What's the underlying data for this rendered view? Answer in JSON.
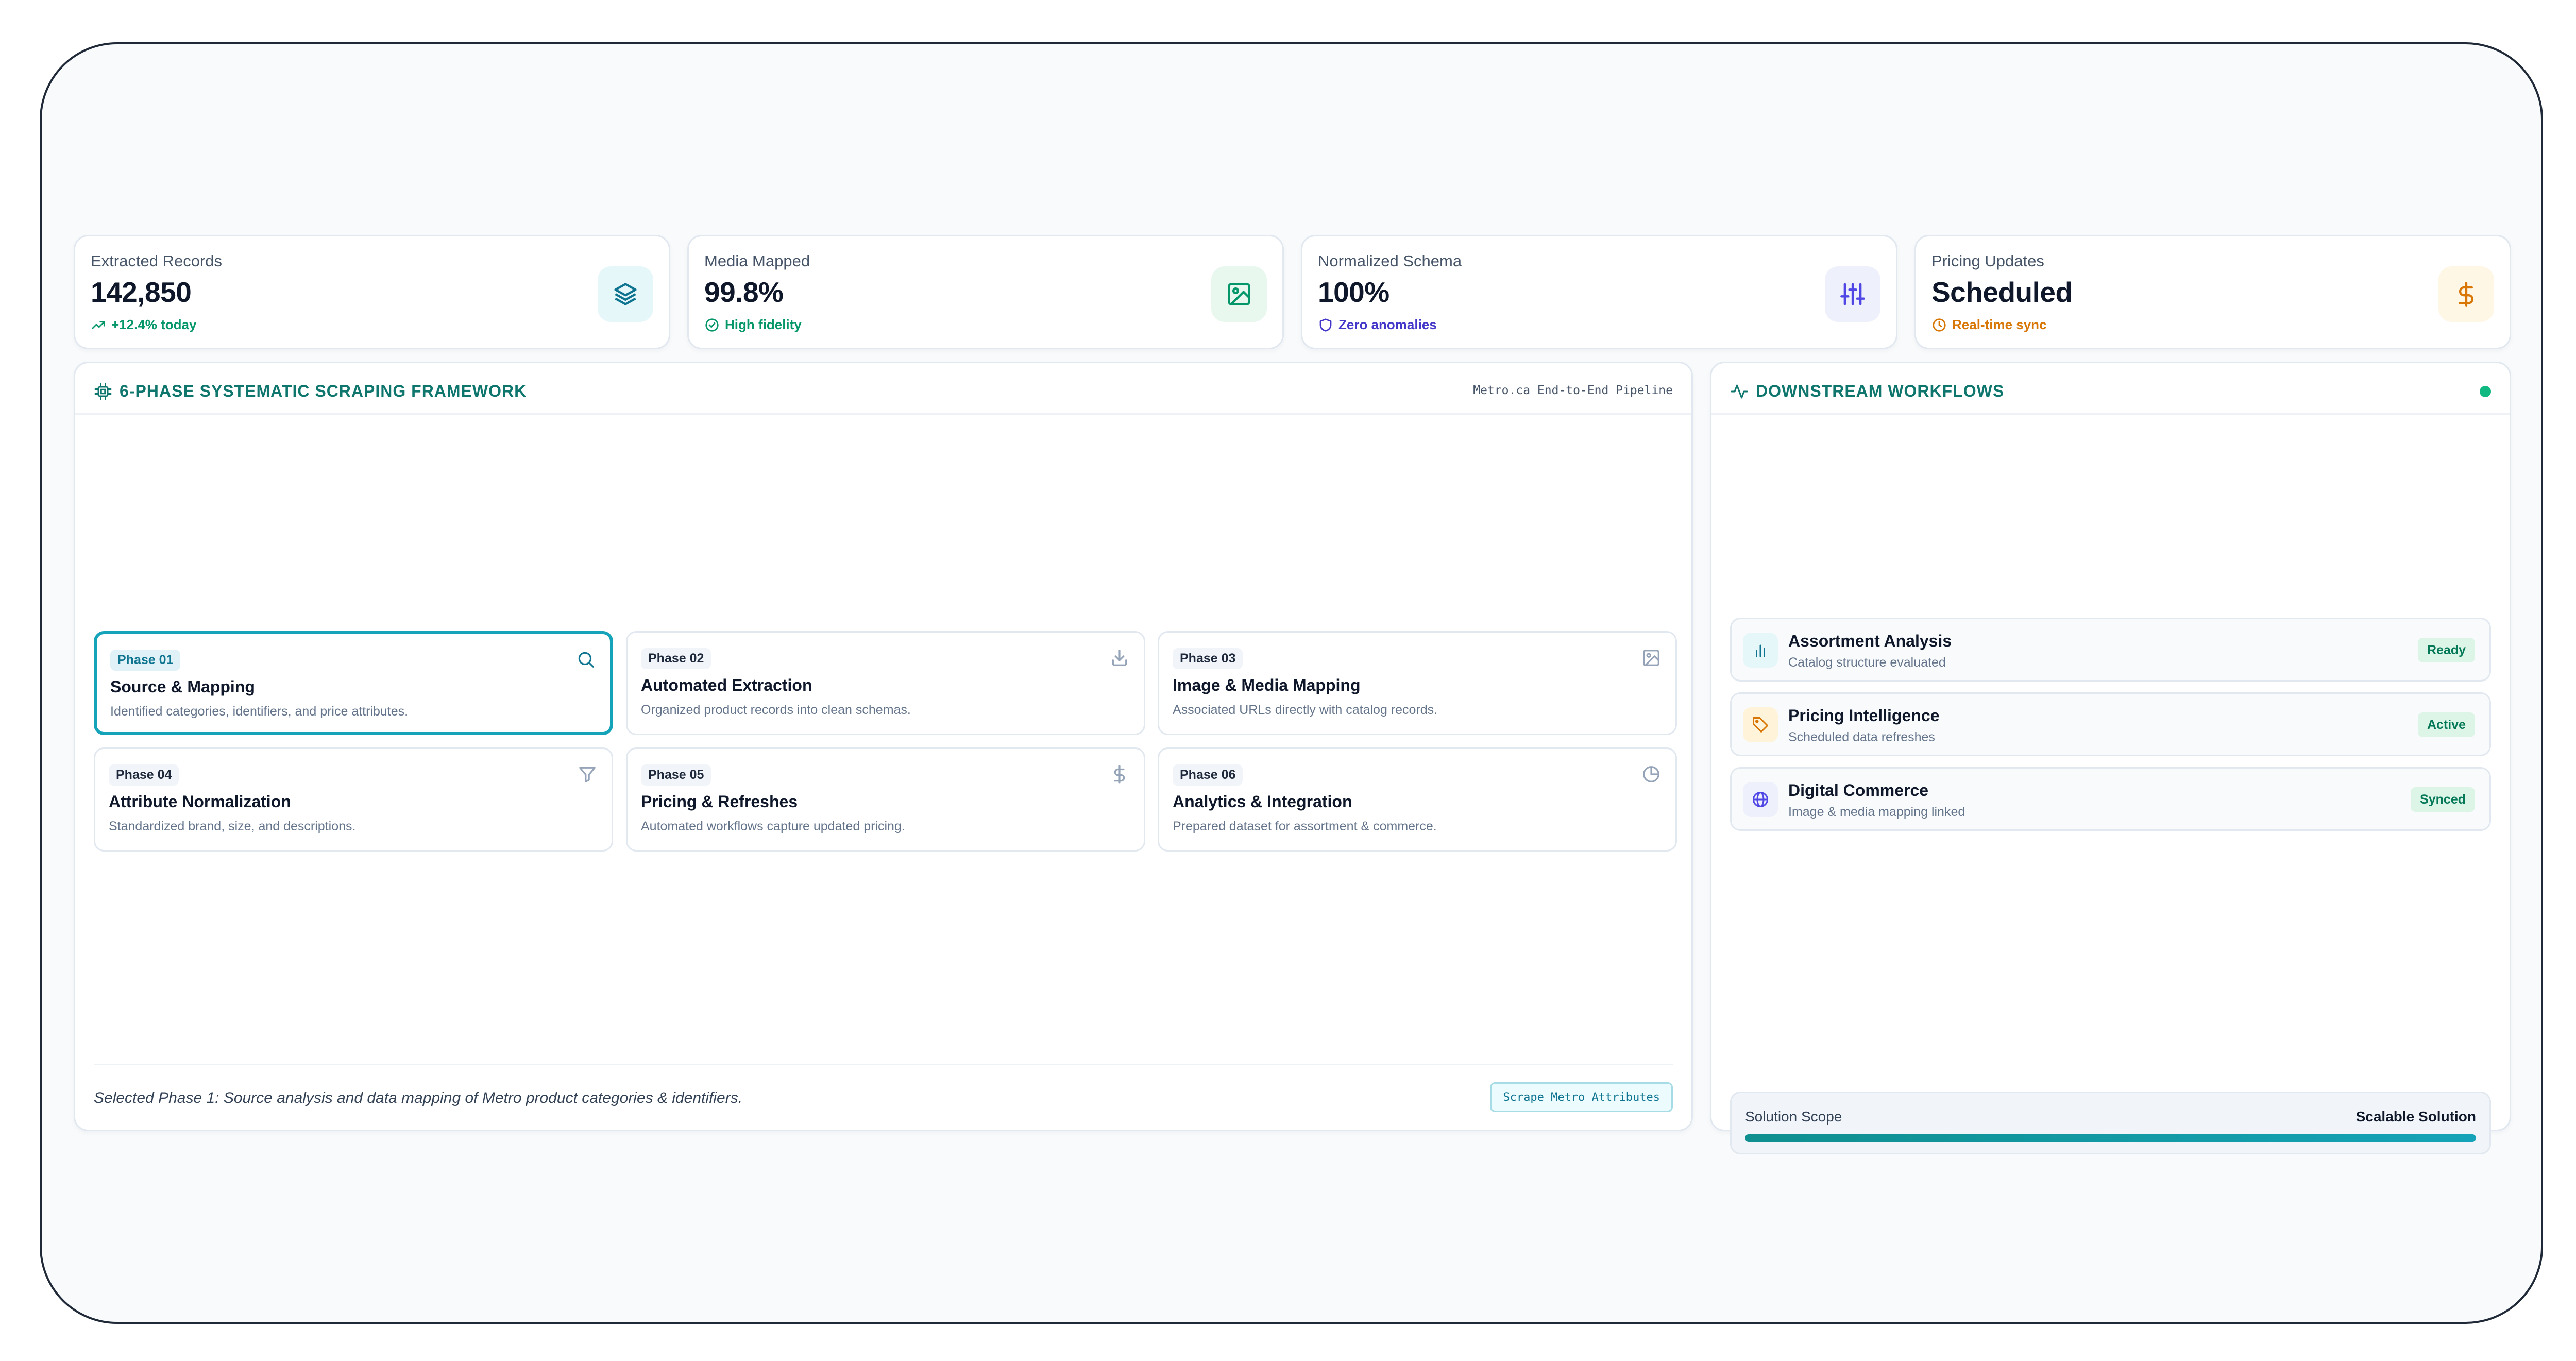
{
  "stats": [
    {
      "label": "Extracted Records",
      "value": "142,850",
      "sub": "+12.4% today",
      "sub_color": "#059669",
      "icon": "layers-icon",
      "icon_bg": "#e6f7fa",
      "icon_color": "#0e7490"
    },
    {
      "label": "Media Mapped",
      "value": "99.8%",
      "sub": "High fidelity",
      "sub_color": "#059669",
      "icon": "image-icon",
      "icon_bg": "#e8f8ef",
      "icon_color": "#059669"
    },
    {
      "label": "Normalized Schema",
      "value": "100%",
      "sub": "Zero anomalies",
      "sub_color": "#4338ca",
      "icon": "sliders-icon",
      "icon_bg": "#eef0fb",
      "icon_color": "#4f46e5"
    },
    {
      "label": "Pricing Updates",
      "value": "Scheduled",
      "sub": "Real-time sync",
      "sub_color": "#d97706",
      "icon": "dollar-icon",
      "icon_bg": "#fff7e6",
      "icon_color": "#d97706"
    }
  ],
  "framework": {
    "title": "6-PHASE SYSTEMATIC SCRAPING FRAMEWORK",
    "tag": "Metro.ca End-to-End Pipeline",
    "phases": [
      {
        "badge": "Phase 01",
        "title": "Source & Mapping",
        "desc": "Identified categories, identifiers, and price attributes.",
        "icon": "search-icon",
        "active": true
      },
      {
        "badge": "Phase 02",
        "title": "Automated Extraction",
        "desc": "Organized product records into clean schemas.",
        "icon": "download-icon",
        "active": false
      },
      {
        "badge": "Phase 03",
        "title": "Image & Media Mapping",
        "desc": "Associated URLs directly with catalog records.",
        "icon": "image-icon",
        "active": false
      },
      {
        "badge": "Phase 04",
        "title": "Attribute Normalization",
        "desc": "Standardized brand, size, and descriptions.",
        "icon": "filter-icon",
        "active": false
      },
      {
        "badge": "Phase 05",
        "title": "Pricing & Refreshes",
        "desc": "Automated workflows capture updated pricing.",
        "icon": "dollar-icon",
        "active": false
      },
      {
        "badge": "Phase 06",
        "title": "Analytics & Integration",
        "desc": "Prepared dataset for assortment & commerce.",
        "icon": "pie-chart-icon",
        "active": false
      }
    ],
    "footer_text": "Selected Phase 1: Source analysis and data mapping of Metro product categories & identifiers.",
    "action_label": "Scrape Metro Attributes"
  },
  "workflows": {
    "title": "DOWNSTREAM WORKFLOWS",
    "items": [
      {
        "title": "Assortment Analysis",
        "sub": "Catalog structure evaluated",
        "status": "Ready",
        "icon": "bar-chart-icon",
        "icon_bg": "#e6f7fa",
        "icon_color": "#0e7490"
      },
      {
        "title": "Pricing Intelligence",
        "sub": "Scheduled data refreshes",
        "status": "Active",
        "icon": "tag-icon",
        "icon_bg": "#fff4d9",
        "icon_color": "#d97706"
      },
      {
        "title": "Digital Commerce",
        "sub": "Image & media mapping linked",
        "status": "Synced",
        "icon": "globe-icon",
        "icon_bg": "#eef0fb",
        "icon_color": "#4f46e5"
      }
    ],
    "status_bg": "#dcf5e7",
    "status_color": "#047857",
    "scope_label": "Solution Scope",
    "scope_value": "Scalable Solution",
    "scope_progress": 1.0
  },
  "colors": {
    "accent": "#0f766e",
    "active_border": "#14a3b8",
    "live_dot": "#10b981"
  }
}
